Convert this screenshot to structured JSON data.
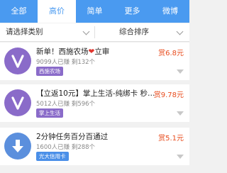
{
  "tabs": [
    {
      "label": "全部"
    },
    {
      "label": "高价"
    },
    {
      "label": "简单"
    },
    {
      "label": "更多"
    },
    {
      "label": "微博"
    }
  ],
  "active_tab": "高价",
  "filters": {
    "category": "请选择类别",
    "sort": "综合排序"
  },
  "tasks": [
    {
      "title_pre": "新单！西施农场",
      "title_post": "立审",
      "stats": "9099人已赚  剩132个",
      "tag": "西施农场",
      "tag_color": "#8a6bc9",
      "avatar_color": "#8a6bc9",
      "avatar_icon": "v-icon",
      "reward": "赏6.8元"
    },
    {
      "title": "【立返10元】掌上生活-纯绑卡 秒…",
      "stats": "5012人已赚  剩596个",
      "tag": "掌上生活",
      "tag_color": "#8a6bc9",
      "avatar_color": "#8a6bc9",
      "avatar_icon": "v-icon",
      "reward": "赏9.78元"
    },
    {
      "title": "2分钟任务百分百通过",
      "stats": "1600人已赚  剩288个",
      "tag": "光大信用卡",
      "tag_color": "#4a8fe8",
      "avatar_color": "#5b8fdd",
      "avatar_icon": "download-arrow-icon",
      "reward": "赏5.1元"
    }
  ],
  "colors": {
    "accent": "#4a9af0",
    "reward": "#e84b1c"
  }
}
